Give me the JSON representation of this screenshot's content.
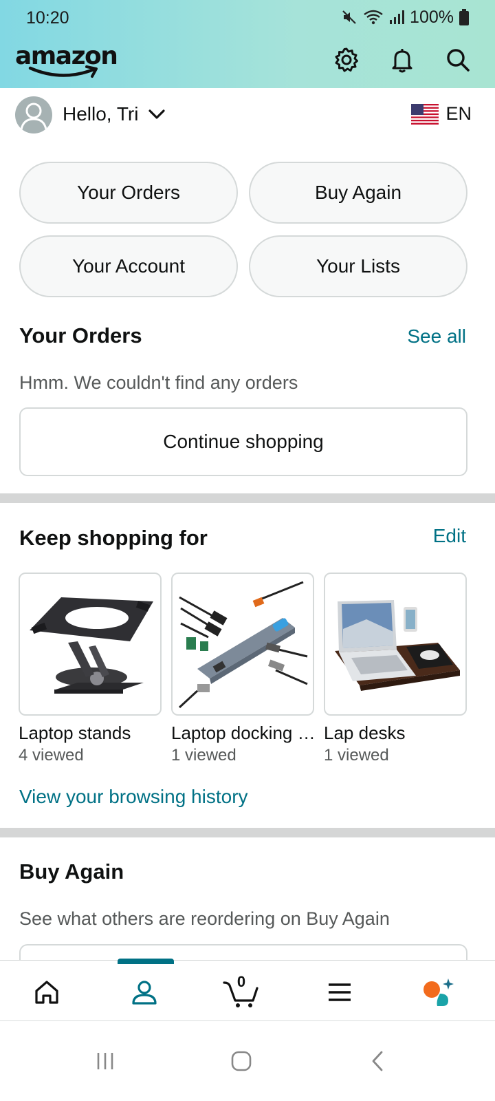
{
  "status_bar": {
    "time": "10:20",
    "battery": "100%"
  },
  "header": {
    "logo": "amazon",
    "icons": [
      "gear-icon",
      "bell-icon",
      "search-icon"
    ]
  },
  "greeting": {
    "text": "Hello, Tri",
    "language": "EN"
  },
  "quick_actions": [
    "Your Orders",
    "Buy Again",
    "Your Account",
    "Your Lists"
  ],
  "orders": {
    "title": "Your Orders",
    "see_all": "See all",
    "empty_text": "Hmm. We couldn't find any orders",
    "continue_button": "Continue shopping"
  },
  "keep_shopping": {
    "title": "Keep shopping for",
    "edit": "Edit",
    "items": [
      {
        "name": "Laptop stands",
        "sub": "4 viewed"
      },
      {
        "name": "Laptop docking stations",
        "sub": "1 viewed"
      },
      {
        "name": "Lap desks",
        "sub": "1 viewed"
      }
    ],
    "history_link": "View your browsing history"
  },
  "buy_again": {
    "title": "Buy Again",
    "text": "See what others are reordering on Buy Again"
  },
  "bottom_nav": {
    "items": [
      "home-icon",
      "account-icon",
      "cart-icon",
      "menu-icon",
      "rufus-icon"
    ],
    "cart_count": "0",
    "active": "account-icon",
    "accent": "#007185"
  },
  "colors": {
    "link": "#007185",
    "text": "#0f1111",
    "muted": "#565959"
  }
}
